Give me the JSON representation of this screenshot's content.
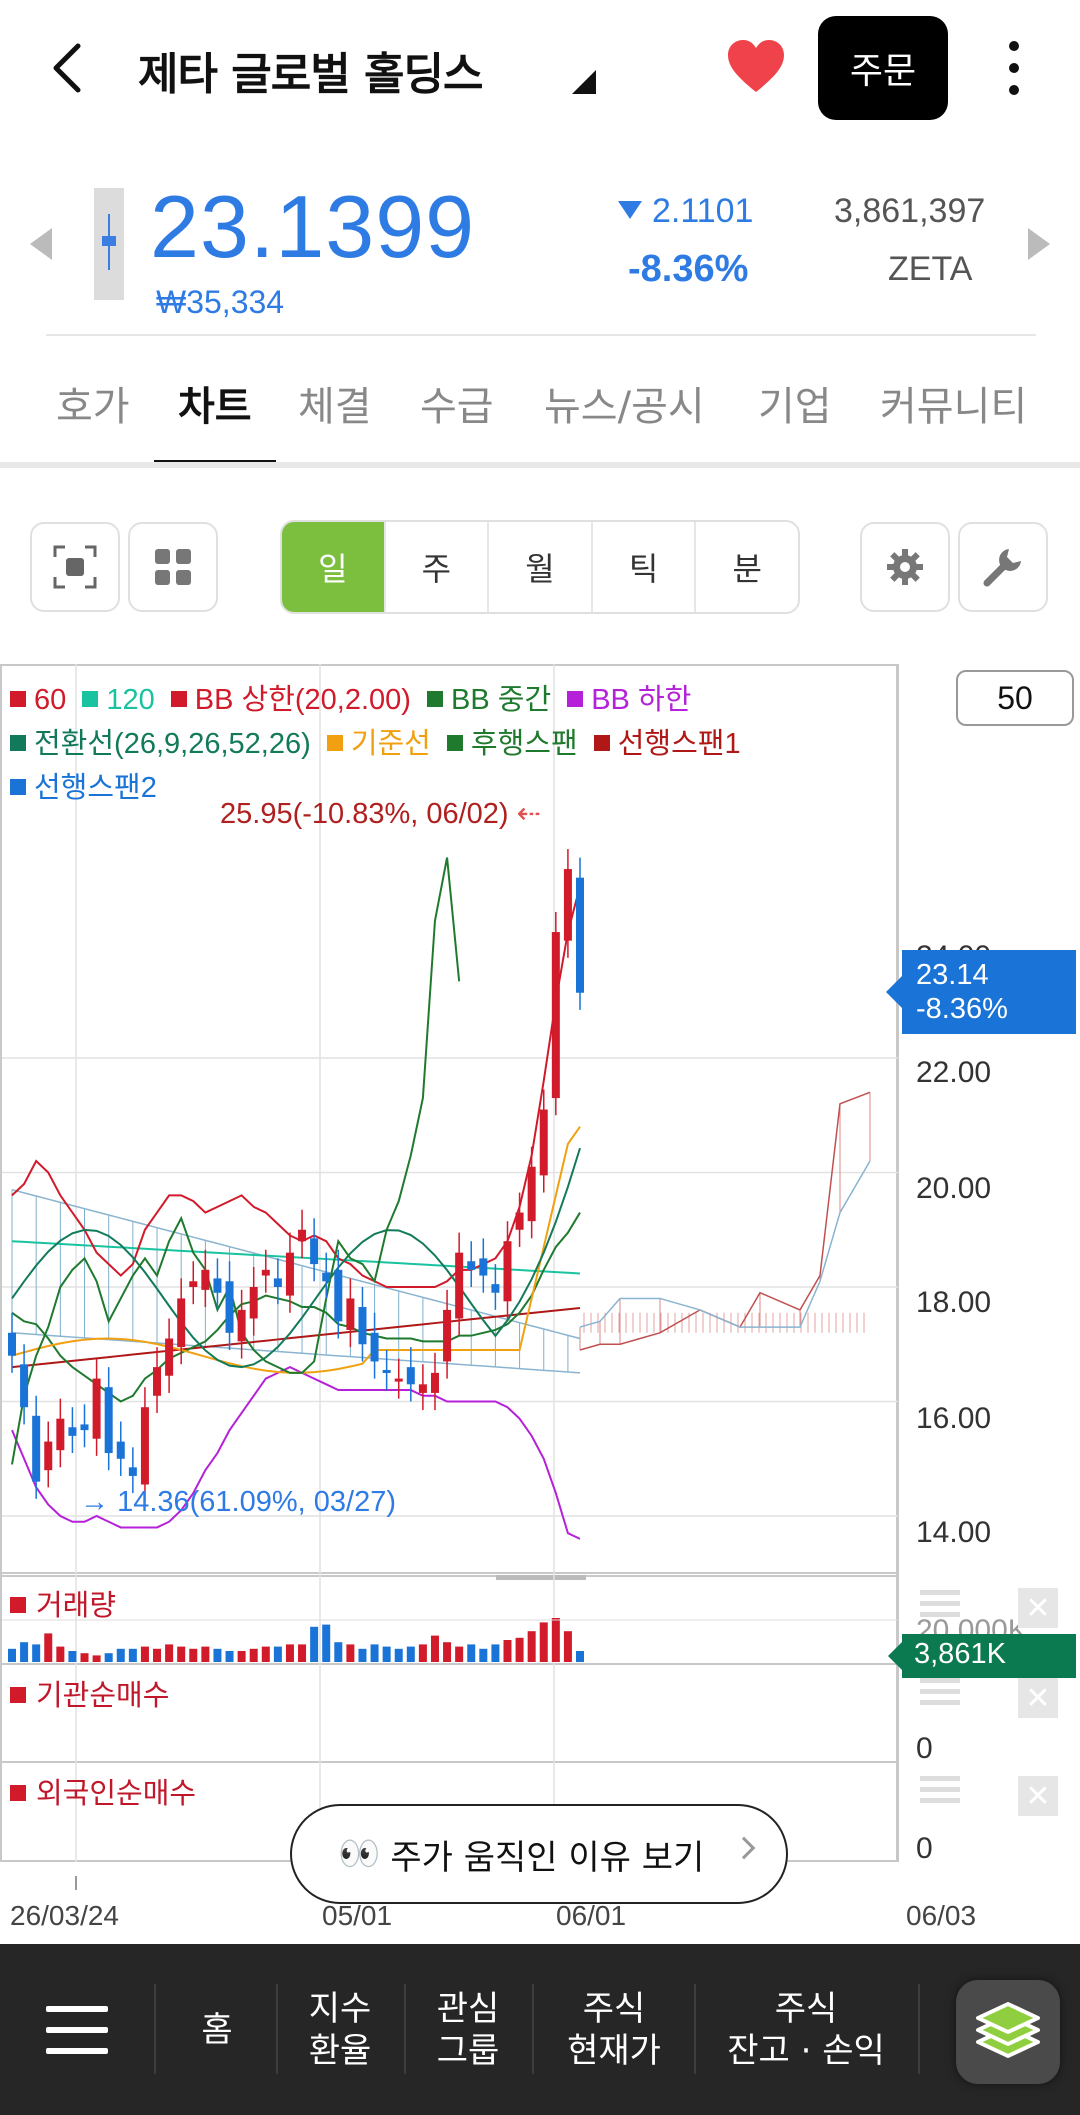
{
  "header": {
    "title": "제타 글로벌 홀딩스",
    "order_label": "주문",
    "icons": {
      "back": "back-chevron-icon",
      "favorite": "heart-icon",
      "more": "more-vertical-icon"
    },
    "favorite_color": "#f0424a"
  },
  "quote": {
    "price": "23.1399",
    "krw": "₩35,334",
    "change_abs": "2.1101",
    "change_pct": "-8.36%",
    "volume": "3,861,397",
    "ticker": "ZETA",
    "price_color": "#2f7be4"
  },
  "tabs": [
    {
      "label": "호가",
      "active": false
    },
    {
      "label": "차트",
      "active": true
    },
    {
      "label": "체결",
      "active": false
    },
    {
      "label": "수급",
      "active": false
    },
    {
      "label": "뉴스/공시",
      "active": false
    },
    {
      "label": "기업",
      "active": false
    },
    {
      "label": "커뮤니티",
      "active": false
    }
  ],
  "toolbar": {
    "icons": [
      "screenshot-icon",
      "grid-icon",
      "gear-icon",
      "wrench-icon"
    ],
    "periods": [
      "일",
      "주",
      "월",
      "틱",
      "분"
    ],
    "active_period": "일",
    "active_color": "#7cbf3f"
  },
  "chart": {
    "legend": [
      {
        "label": "60",
        "color": "#d11a2a"
      },
      {
        "label": "120",
        "color": "#19c3a0"
      },
      {
        "label": "BB 상한(20,2.00)",
        "color": "#d11a2a"
      },
      {
        "label": "BB 중간",
        "color": "#1f7a2e"
      },
      {
        "label": "BB 하한",
        "color": "#b521d8"
      },
      {
        "label": "전환선(26,9,26,52,26)",
        "color": "#127a5a"
      },
      {
        "label": "기준선",
        "color": "#f0a010"
      },
      {
        "label": "후행스팬",
        "color": "#1f7a2e"
      },
      {
        "label": "선행스팬1",
        "color": "#b01818"
      },
      {
        "label": "선행스팬2",
        "color": "#1a73d6"
      }
    ],
    "candle_count": "50",
    "price_axis": [
      "24.00",
      "22.00",
      "20.00",
      "18.00",
      "16.00",
      "14.00"
    ],
    "current_tag": {
      "price": "23.14",
      "pct": "-8.36%"
    },
    "high_label": "25.95(-10.83%, 06/02)",
    "low_label": "14.36(61.09%, 03/27)",
    "volume_label": "거래량",
    "volume_axis": "20,000K",
    "volume_tag": "3,861K",
    "inst_label": "기관순매수",
    "inst_axis": "0",
    "foreign_label": "외국인순매수",
    "foreign_axis": "0",
    "dates": [
      "26/03/24",
      "05/01",
      "06/01",
      "06/03"
    ],
    "reason_button": "주가 움직인 이유 보기",
    "reason_emoji": "👀"
  },
  "chart_data": {
    "type": "candlestick",
    "ylim": [
      13.5,
      25.95
    ],
    "x": [
      "26/03/24",
      "05/01",
      "06/01",
      "06/03"
    ],
    "high": 25.95,
    "low": 14.36,
    "last": 23.14,
    "closes": [
      16.8,
      15.9,
      14.6,
      15.3,
      15.7,
      15.4,
      15.5,
      16.4,
      15.1,
      15.0,
      14.7,
      15.9,
      16.6,
      17.1,
      17.8,
      18.1,
      18.3,
      17.9,
      17.2,
      17.6,
      18.0,
      18.3,
      18.0,
      18.6,
      19.0,
      18.4,
      18.1,
      17.4,
      17.8,
      17.0,
      16.7,
      16.5,
      16.4,
      16.3,
      16.3,
      16.5,
      17.6,
      18.6,
      18.3,
      18.2,
      17.9,
      18.8,
      19.3,
      20.1,
      21.1,
      24.2,
      25.3,
      23.14
    ],
    "volume": [
      6,
      9,
      8,
      13,
      7,
      5,
      4,
      3,
      4,
      6,
      6,
      7,
      6,
      8,
      7,
      6,
      7,
      6,
      5,
      5,
      6,
      7,
      7,
      8,
      8,
      16,
      17,
      9,
      8,
      6,
      8,
      7,
      6,
      7,
      8,
      12,
      9,
      7,
      8,
      6,
      8,
      10,
      11,
      14,
      18,
      20,
      14,
      5
    ]
  },
  "bottom_nav": {
    "items": [
      "홈",
      "지수\n환율",
      "관심\n그룹",
      "주식\n현재가",
      "주식\n잔고 · 손익"
    ],
    "icons": {
      "menu": "hamburger-menu-icon",
      "layers": "layers-icon"
    }
  }
}
